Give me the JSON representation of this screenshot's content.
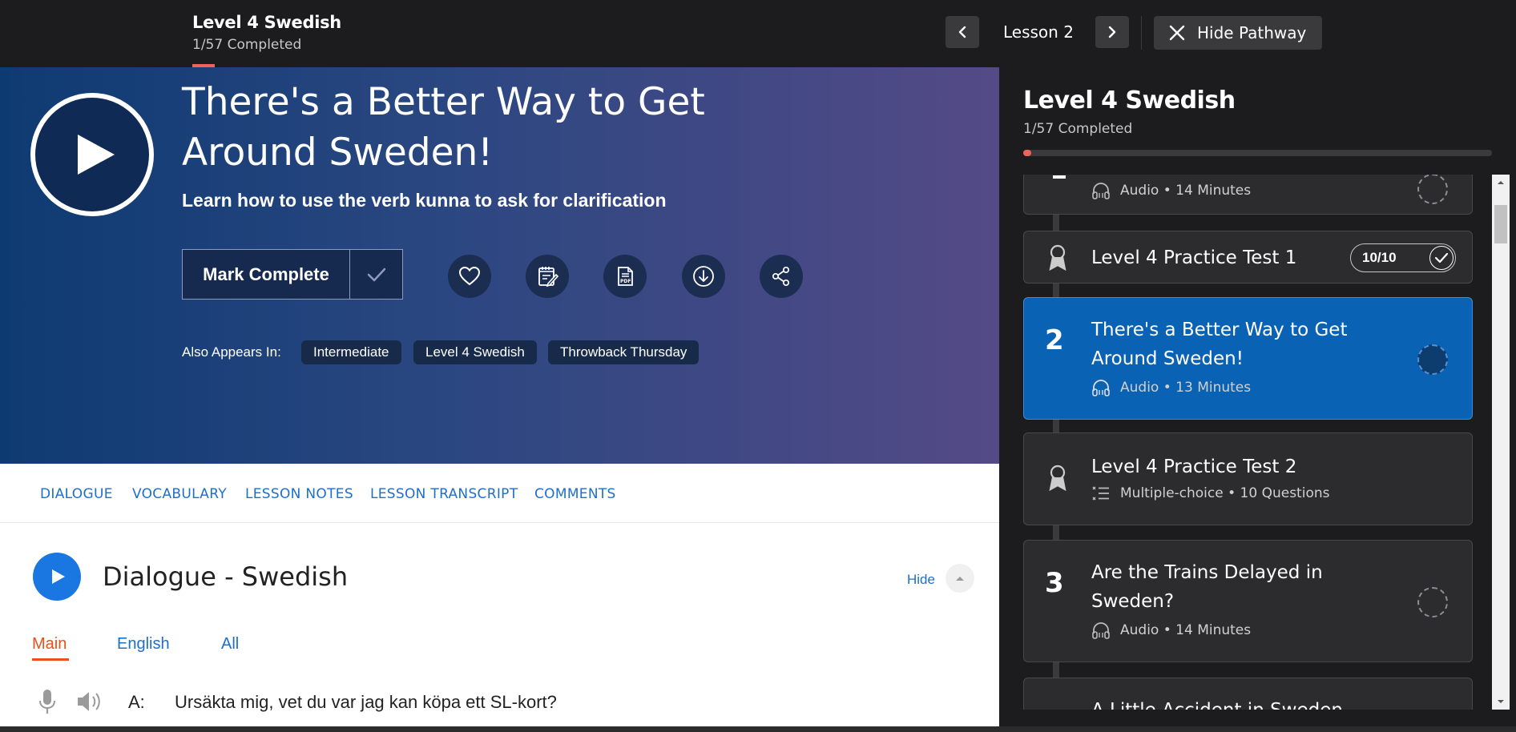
{
  "topbar": {
    "title": "Level 4 Swedish",
    "completed": "1/57 Completed",
    "lesson_label": "Lesson 2",
    "hide_pathway": "Hide Pathway"
  },
  "hero": {
    "title": "There's a Better Way to Get Around Sweden!",
    "subtitle": "Learn how to use the verb kunna to ask for clarification",
    "mark_complete": "Mark Complete",
    "also_appears_in": "Also Appears In:",
    "tags": [
      "Intermediate",
      "Level 4 Swedish",
      "Throwback Thursday"
    ],
    "icons": [
      "heart-icon",
      "notebook-icon",
      "pdf-icon",
      "download-icon",
      "share-icon"
    ]
  },
  "main": {
    "tabs": [
      "DIALOGUE",
      "VOCABULARY",
      "LESSON NOTES",
      "LESSON TRANSCRIPT",
      "COMMENTS"
    ],
    "dialogue_title": "Dialogue - Swedish",
    "hide_label": "Hide",
    "sub_tabs": [
      "Main",
      "English",
      "All"
    ],
    "line": {
      "speaker": "A:",
      "text": "Ursäkta mig, vet du var jag kan köpa ett SL-kort?"
    }
  },
  "sidebar": {
    "title": "Level 4 Swedish",
    "completed": "1/57 Completed",
    "progress_fraction": 0.0175,
    "items": [
      {
        "num": "",
        "title": "",
        "meta": "Audio • 14 Minutes",
        "type": "audio"
      },
      {
        "num": "",
        "title": "Level 4 Practice Test 1",
        "score": "10/10",
        "type": "test-done"
      },
      {
        "num": "2",
        "title": "There's a Better Way to Get Around Sweden!",
        "meta": "Audio • 13 Minutes",
        "type": "audio",
        "active": true
      },
      {
        "num": "",
        "title": "Level 4 Practice Test 2",
        "meta": "Multiple-choice • 10 Questions",
        "type": "test"
      },
      {
        "num": "3",
        "title": "Are the Trains Delayed in Sweden?",
        "meta": "Audio • 14 Minutes",
        "type": "audio"
      },
      {
        "num": "",
        "title": "A Little Accident in Sweden",
        "type": "audio"
      }
    ]
  },
  "colors": {
    "accent_blue": "#1e6fc7",
    "active_card": "#0a62b4",
    "progress_red": "#f0625c",
    "active_tab": "#e8501c"
  }
}
